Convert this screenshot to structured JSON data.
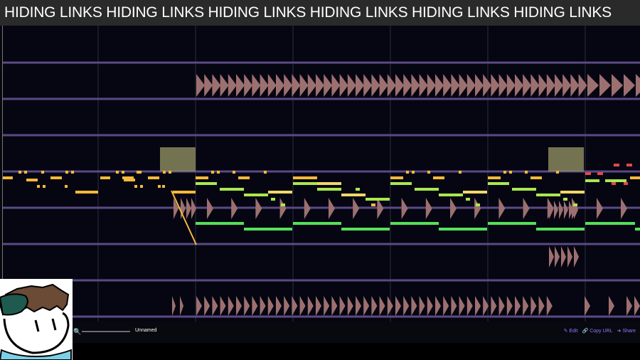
{
  "header": {
    "title": "HIDING LINKS HIDING LINKS HIDING LINKS HIDING LINKS HIDING LINKS HIDING LINKS"
  },
  "footer": {
    "song_name": "Unnamed",
    "edit_label": "Edit",
    "copy_url_label": "Copy URL",
    "share_label": "Share",
    "icons": {
      "zoom": "magnifier-icon",
      "edit": "pencil-icon",
      "copy": "link-icon",
      "share": "share-icon"
    }
  },
  "colors": {
    "background": "#060612",
    "channel_line": "#5a4a84",
    "bar_line": "#2c2c44",
    "pitch_orange": "#f5b93b",
    "pitch_yellow": "#f0d76a",
    "pitch_lime": "#a9e84f",
    "pitch_green": "#55e05a",
    "pitch_red": "#e34848",
    "noise_note": "#9d7070",
    "loop_marker": "#8f8f62",
    "accent_link": "#8a7cff"
  }
}
